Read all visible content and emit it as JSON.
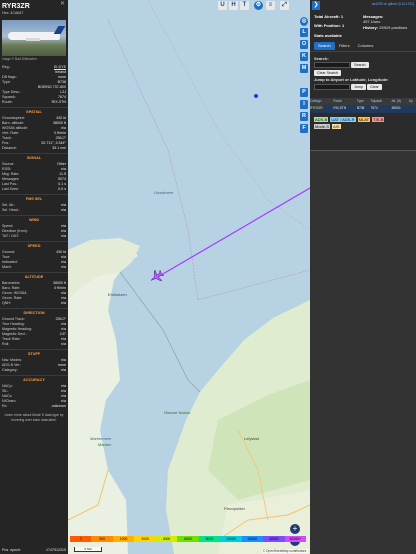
{
  "aircraft": {
    "callsign": "RYR3ZR",
    "hex": "Hex:  4CA647",
    "image_credit": "Image © Bart Dihlbacher",
    "registration": "EI-DYE",
    "country": "Ireland",
    "db_flags": "none",
    "type": "B738",
    "type_full": "BOEING 737-800",
    "type_desc": "L2J",
    "squawk": "7674",
    "route": "RIX-STN"
  },
  "left_rows": {
    "reg": "Reg.:",
    "country_label": "",
    "db_flags": "DB flags:",
    "type": "Type:",
    "type_desc": "Type Desc.:",
    "squawk": "Squawk:",
    "route": "Route:"
  },
  "spatial": {
    "title": "SPATIAL",
    "rows": [
      [
        "Groundspeed:",
        "430 kt"
      ],
      [
        "Baro. altitude:",
        "38000 ft"
      ],
      [
        "WGS84 altitude:",
        "n/a"
      ],
      [
        "Vert. Rate:",
        "0 ft/min"
      ],
      [
        "Track:",
        "236.0°"
      ],
      [
        "Pos.:",
        "52.711°, 5.344°"
      ],
      [
        "Distance:",
        "35.1 nmi"
      ]
    ]
  },
  "signal": {
    "title": "SIGNAL",
    "rows": [
      [
        "Source:",
        "Other"
      ],
      [
        "RSSI:",
        "n/a"
      ],
      [
        "Msg. Rate:",
        "11.5"
      ],
      [
        "Messages:",
        "9074"
      ],
      [
        "Last Pos.:",
        "0.1 s"
      ],
      [
        "Last Seen:",
        "0.0 s"
      ]
    ]
  },
  "fms": {
    "title": "FMS SEL",
    "rows": [
      [
        "Sel. Alt.:",
        "n/a"
      ],
      [
        "Sel. Head.:",
        "n/a"
      ]
    ]
  },
  "wind": {
    "title": "WIND",
    "rows": [
      [
        "Speed:",
        "n/a"
      ],
      [
        "Direction (from):",
        "n/a"
      ],
      [
        "TAT / OAT:",
        "n/a"
      ]
    ]
  },
  "speed": {
    "title": "SPEED",
    "rows": [
      [
        "Ground:",
        "430 kt"
      ],
      [
        "True:",
        "n/a"
      ],
      [
        "Indicated:",
        "n/a"
      ],
      [
        "Mach:",
        "n/a"
      ]
    ]
  },
  "altitude": {
    "title": "ALTITUDE",
    "rows": [
      [
        "Barometric:",
        "38000 ft"
      ],
      [
        "Baro. Rate:",
        "0 ft/min"
      ],
      [
        "Geom. WGS84:",
        "n/a"
      ],
      [
        "Geom. Rate:",
        "n/a"
      ],
      [
        "QNH:",
        "n/a"
      ]
    ]
  },
  "direction": {
    "title": "DIRECTION",
    "rows": [
      [
        "Ground Track:",
        "236.0°"
      ],
      [
        "True Heading:",
        "n/a"
      ],
      [
        "Magnetic Heading:",
        "n/a"
      ],
      [
        "Magnetic Decl.:",
        "2.8°"
      ],
      [
        "Track Rate:",
        "n/a"
      ],
      [
        "Roll:",
        "n/a"
      ]
    ]
  },
  "stuff": {
    "title": "STUFF",
    "rows": [
      [
        "Nav. Modes:",
        "n/a"
      ],
      [
        "ADS-B Ver.:",
        "none"
      ],
      [
        "Category:",
        "n/a"
      ]
    ]
  },
  "accuracy": {
    "title": "ACCURACY",
    "rows": [
      [
        "NACp:",
        "n/a"
      ],
      [
        "SIL:",
        "n/a"
      ],
      [
        "NACv:",
        "n/a"
      ],
      [
        "NICbaro:",
        "n/a"
      ],
      [
        "Rc:",
        "unknown"
      ]
    ]
  },
  "footer_note": "Learn more about Mode S data type by hovering over each data label.",
  "pos_epoch": {
    "label": "Pos. epoch:",
    "value": "1747912315"
  },
  "map": {
    "buttons_top": [
      "U",
      "H",
      "T"
    ],
    "side_buttons": [
      "L",
      "O",
      "K",
      "M",
      "P",
      "I",
      "R",
      "F"
    ],
    "zoom_in": "+",
    "zoom_out": "−",
    "labels": {
      "water1": "IJsselmeer",
      "land1": "Markermeer",
      "land2": "Lelystad",
      "land3": "Flevopolder",
      "land4": "Marken",
      "land5": "Nieuwe Natuur",
      "town1": "Enkhuizen"
    },
    "legend": [
      "0",
      "500",
      "1000",
      "2000",
      "4000",
      "6000",
      "8000",
      "10000",
      "20000",
      "30000",
      "40000+"
    ],
    "legend_colors": [
      "#ff5c00",
      "#ff8b00",
      "#ffb000",
      "#ffd500",
      "#d4ec00",
      "#6fe000",
      "#00e38a",
      "#00d0d6",
      "#1c8fff",
      "#7a4dff",
      "#d24cff",
      "#ff3cc0"
    ],
    "scale": "5 NM",
    "attribution": "© OpenStreetMap contributors."
  },
  "right": {
    "toplinks": "tar1090 on github (3.14.1701)",
    "total_label": "Total Aircraft:",
    "total_value": "1",
    "with_pos_label": "With Position:",
    "with_pos_value": "1",
    "stats_label": "Stats available",
    "messages_label": "Messages:",
    "messages_value": "457.1/sec",
    "history_label": "History:",
    "history_value": "25919 positions",
    "tabs": [
      "Search",
      "Filters",
      "Columns"
    ],
    "search_label": "Search:",
    "search_button": "Search",
    "clear_search": "Clear Search",
    "jump_label": "Jump to Airport or Latitude, Longitude:",
    "jump_button": "Jump",
    "clear_button": "Clear",
    "table_headers": [
      "Callsign",
      "Route",
      "Type",
      "Squawk",
      "Alt. (ft)",
      "Sp"
    ],
    "table_row": [
      "RYR3ZR",
      "RIX-STN",
      "B738",
      "7674",
      "38000"
    ],
    "sources_line1": [
      "ADS-B",
      "UAT / ADS-R",
      "MLAT",
      "TIS-B"
    ],
    "sources_line2": [
      "Mode-S",
      "AIS"
    ]
  }
}
